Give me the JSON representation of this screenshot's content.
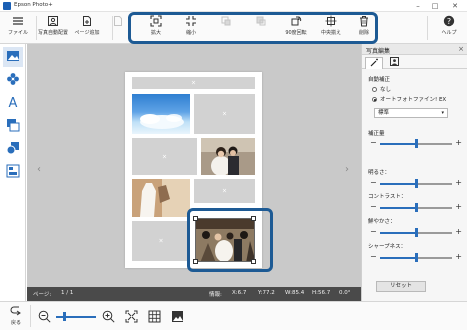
{
  "window": {
    "title": "Epson Photo+"
  },
  "toolbar": {
    "file": "ファイル",
    "auto_layout": "写真自動配置",
    "add_page": "ページ追加",
    "zoom_in": "拡大",
    "zoom_out": "縮小",
    "btn_disabled_1": "",
    "btn_disabled_2": "",
    "rotate90": "90度回転",
    "center_align": "中央揃え",
    "delete": "削除",
    "help": "ヘルプ"
  },
  "right_panel": {
    "title": "写真編集",
    "auto_correct": "自動補正",
    "options": [
      "なし",
      "オートフォトファイン! EX"
    ],
    "selected_option": 1,
    "mode_select": "標準",
    "correction_amount": "補正量",
    "brightness": "明るさ：",
    "contrast": "コントラスト：",
    "saturation": "鮮やかさ：",
    "sharpness": "シャープネス：",
    "reset": "リセット",
    "levels": {
      "correction_amount": 0.5,
      "brightness": 0.5,
      "contrast": 0.5,
      "saturation": 0.5,
      "sharpness": 0.5
    }
  },
  "status": {
    "page_label": "ページ:",
    "page_value": "1 / 1",
    "info_label": "情報:",
    "x": "X:6.7",
    "y": "Y:77.2",
    "w": "W:85.4",
    "h": "H:56.7",
    "angle": "0.0°"
  },
  "bottom": {
    "back": "戻る",
    "zoom_level": 0.2
  },
  "colors": {
    "highlight": "#1d5a94",
    "accent": "#2a6ebb",
    "status_bar": "#4a4a4a",
    "canvas": "#c9c9c9"
  }
}
